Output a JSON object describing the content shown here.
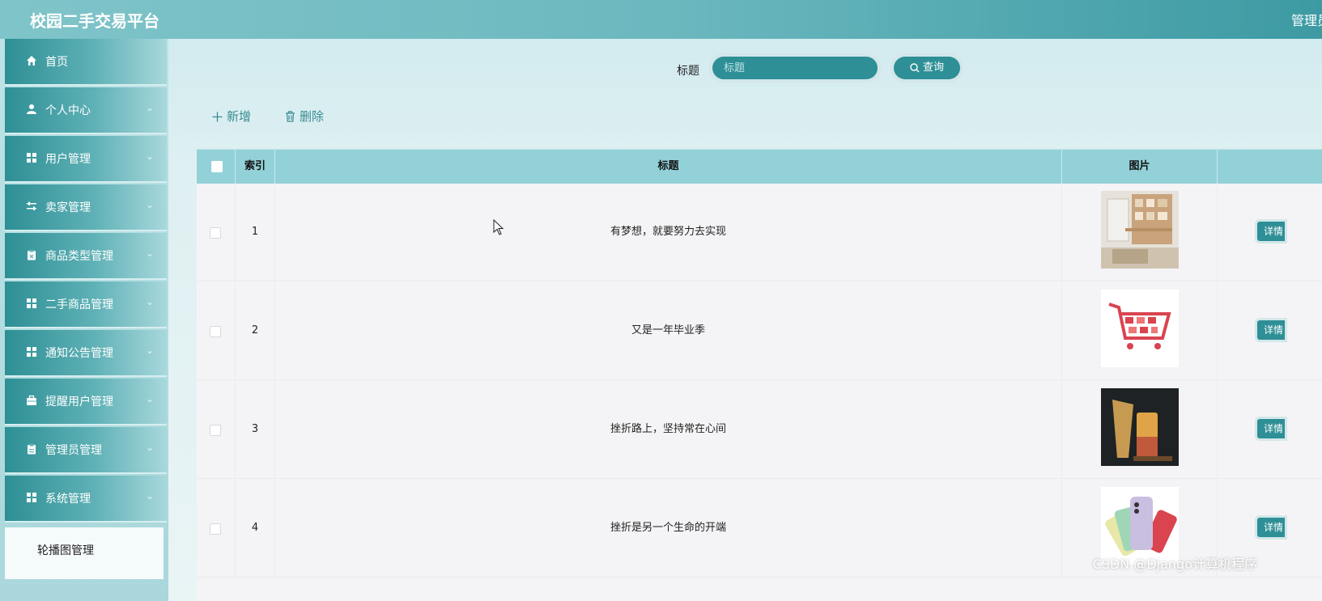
{
  "header": {
    "title": "校园二手交易平台",
    "user_menu": "管理员"
  },
  "sidebar": {
    "items": [
      {
        "label": "首页",
        "icon": "home-icon",
        "has_arrow": false
      },
      {
        "label": "个人中心",
        "icon": "user-icon",
        "has_arrow": true
      },
      {
        "label": "用户管理",
        "icon": "grid-icon",
        "has_arrow": true
      },
      {
        "label": "卖家管理",
        "icon": "sliders-icon",
        "has_arrow": true
      },
      {
        "label": "商品类型管理",
        "icon": "clipboard-icon",
        "has_arrow": true
      },
      {
        "label": "二手商品管理",
        "icon": "grid-icon",
        "has_arrow": true
      },
      {
        "label": "通知公告管理",
        "icon": "grid-icon",
        "has_arrow": true
      },
      {
        "label": "提醒用户管理",
        "icon": "briefcase-icon",
        "has_arrow": true
      },
      {
        "label": "管理员管理",
        "icon": "clipboard-icon",
        "has_arrow": true
      },
      {
        "label": "系统管理",
        "icon": "grid-icon",
        "has_arrow": true
      }
    ],
    "sub_item": "轮播图管理"
  },
  "search": {
    "label": "标题",
    "placeholder": "标题",
    "button": "查询"
  },
  "actions": {
    "add": "新增",
    "delete": "删除"
  },
  "table": {
    "headers": {
      "index": "索引",
      "title": "标题",
      "image": "图片"
    },
    "rows": [
      {
        "index": "1",
        "title": "有梦想，就要努力去实现",
        "image": "desk-photo"
      },
      {
        "index": "2",
        "title": "又是一年毕业季",
        "image": "shopping-cart-photo"
      },
      {
        "index": "3",
        "title": "挫折路上，坚持常在心间",
        "image": "drinks-photo"
      },
      {
        "index": "4",
        "title": "挫折是另一个生命的开端",
        "image": "phone-photo"
      }
    ],
    "row_action": "详情"
  },
  "watermark": "CSDN @Django计算机程序",
  "colors": {
    "accent": "#2e8f96",
    "header": "#6cb8bf",
    "table_header": "#93d1d8"
  }
}
